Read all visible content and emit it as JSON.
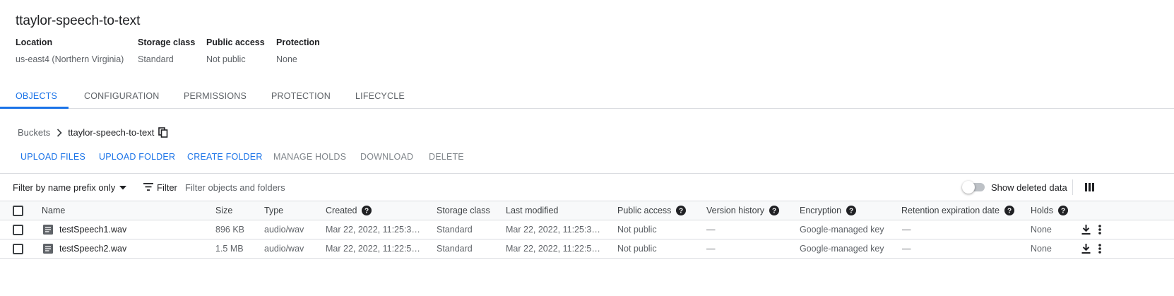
{
  "bucket": {
    "title": "ttaylor-speech-to-text"
  },
  "info": [
    {
      "label": "Location",
      "value": "us-east4 (Northern Virginia)"
    },
    {
      "label": "Storage class",
      "value": "Standard"
    },
    {
      "label": "Public access",
      "value": "Not public"
    },
    {
      "label": "Protection",
      "value": "None"
    }
  ],
  "tabs": [
    {
      "label": "OBJECTS",
      "active": true
    },
    {
      "label": "CONFIGURATION",
      "active": false
    },
    {
      "label": "PERMISSIONS",
      "active": false
    },
    {
      "label": "PROTECTION",
      "active": false
    },
    {
      "label": "LIFECYCLE",
      "active": false
    }
  ],
  "breadcrumb": {
    "root": "Buckets",
    "current": "ttaylor-speech-to-text"
  },
  "actions": [
    {
      "label": "UPLOAD FILES",
      "enabled": true
    },
    {
      "label": "UPLOAD FOLDER",
      "enabled": true
    },
    {
      "label": "CREATE FOLDER",
      "enabled": true
    },
    {
      "label": "MANAGE HOLDS",
      "enabled": false
    },
    {
      "label": "DOWNLOAD",
      "enabled": false
    },
    {
      "label": "DELETE",
      "enabled": false
    }
  ],
  "filterbar": {
    "prefix_label": "Filter by name prefix only",
    "filter_label": "Filter",
    "placeholder": "Filter objects and folders",
    "show_deleted_label": "Show deleted data",
    "show_deleted_on": false
  },
  "table": {
    "headers": {
      "name": "Name",
      "size": "Size",
      "type": "Type",
      "created": "Created",
      "storage_class": "Storage class",
      "last_modified": "Last modified",
      "public_access": "Public access",
      "version_history": "Version history",
      "encryption": "Encryption",
      "retention": "Retention expiration date",
      "holds": "Holds"
    },
    "rows": [
      {
        "name": "testSpeech1.wav",
        "size": "896 KB",
        "type": "audio/wav",
        "created": "Mar 22, 2022, 11:25:3…",
        "storage_class": "Standard",
        "last_modified": "Mar 22, 2022, 11:25:3…",
        "public_access": "Not public",
        "version_history": "—",
        "encryption": "Google-managed key",
        "retention": "—",
        "holds": "None"
      },
      {
        "name": "testSpeech2.wav",
        "size": "1.5 MB",
        "type": "audio/wav",
        "created": "Mar 22, 2022, 11:22:5…",
        "storage_class": "Standard",
        "last_modified": "Mar 22, 2022, 11:22:5…",
        "public_access": "Not public",
        "version_history": "—",
        "encryption": "Google-managed key",
        "retention": "—",
        "holds": "None"
      }
    ]
  },
  "colors": {
    "accent": "#1a73e8",
    "text": "#202124",
    "muted": "#5f6368",
    "border": "#dadce0"
  }
}
